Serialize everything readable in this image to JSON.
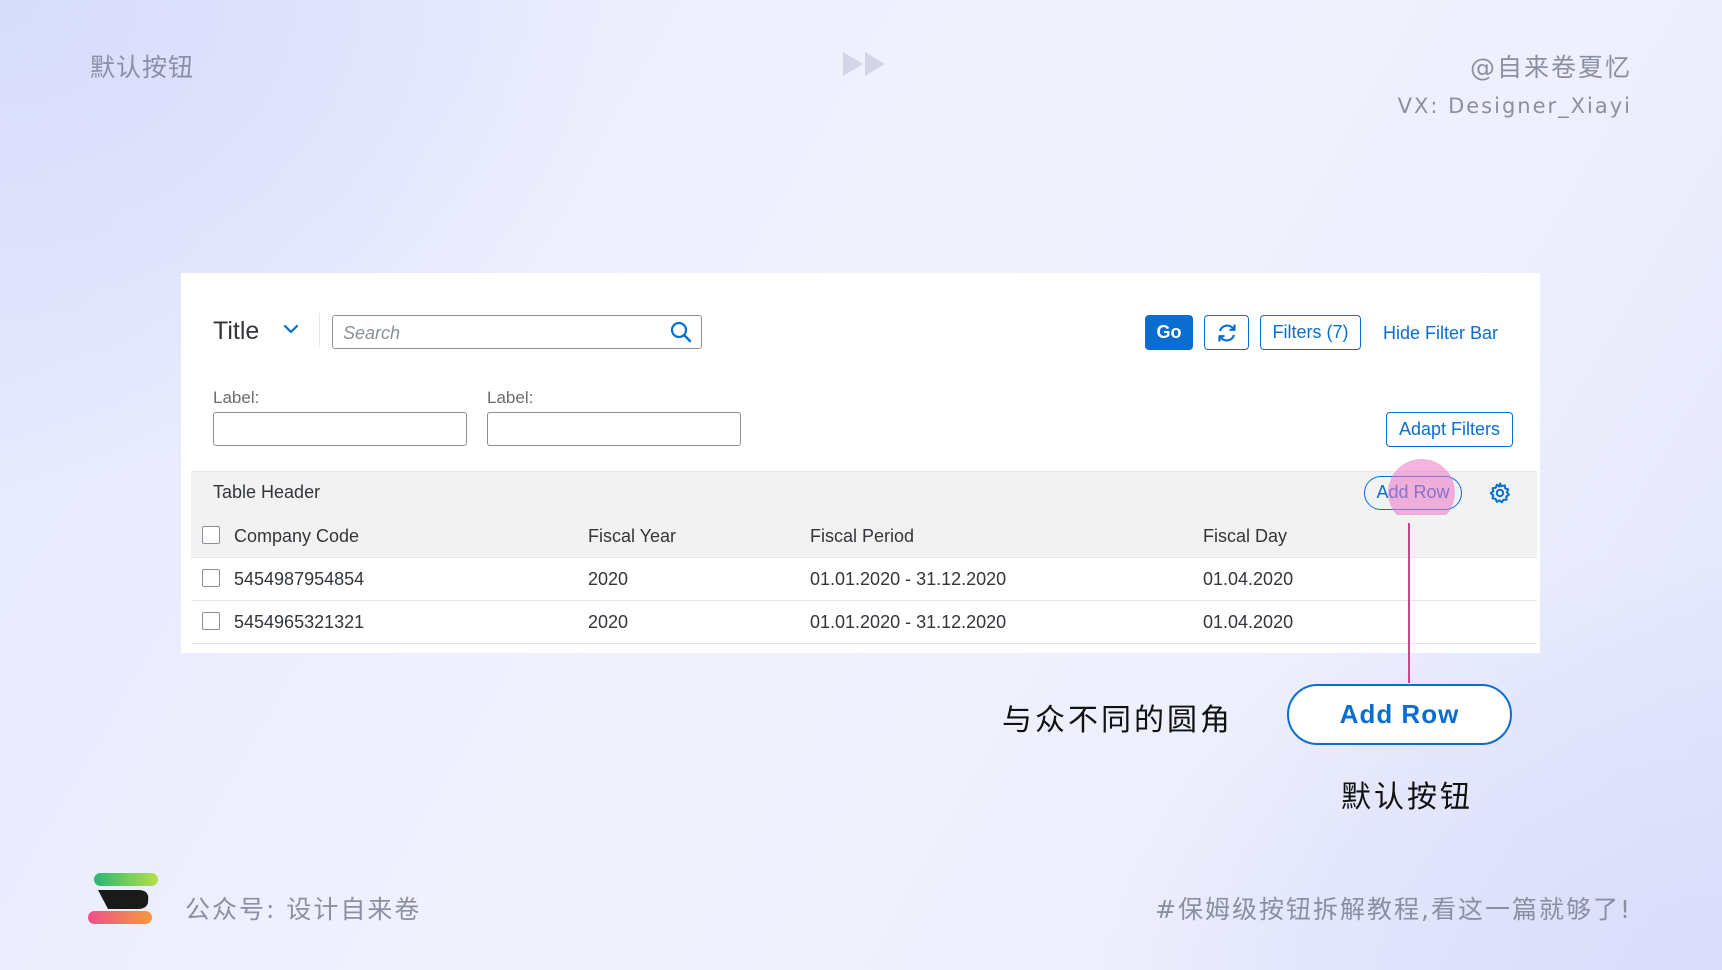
{
  "slide": {
    "top_left_title": "默认按钮",
    "author": "@自来卷夏忆",
    "vx": "VX: Designer_Xiayi",
    "footer_left": "公众号: 设计自来卷",
    "footer_right": "#保姆级按钮拆解教程,看这一篇就够了!"
  },
  "toolbar": {
    "title": "Title",
    "search_placeholder": "Search",
    "go_label": "Go",
    "filters_label": "Filters (7)",
    "hide_filter_label": "Hide Filter Bar"
  },
  "filter_bar": {
    "label_1": "Label:",
    "label_2": "Label:",
    "adapt_filters_label": "Adapt Filters"
  },
  "table": {
    "header_title": "Table Header",
    "add_row_label": "Add Row",
    "columns": [
      "Company Code",
      "Fiscal Year",
      "Fiscal Period",
      "Fiscal Day"
    ],
    "rows": [
      [
        "5454987954854",
        "2020",
        "01.01.2020 - 31.12.2020",
        "01.04.2020"
      ],
      [
        "5454965321321",
        "2020",
        "01.01.2020 - 31.12.2020",
        "01.04.2020"
      ]
    ]
  },
  "annotation": {
    "note": "与众不同的圆角",
    "button_label": "Add Row",
    "caption": "默认按钮"
  },
  "colors": {
    "accent": "#0a6ed1",
    "highlight": "#ec76c4",
    "connector": "#d63f8a"
  },
  "icons": [
    "chevron-down-icon",
    "search-icon",
    "refresh-icon",
    "gear-icon",
    "play-icon",
    "brand-logo"
  ]
}
